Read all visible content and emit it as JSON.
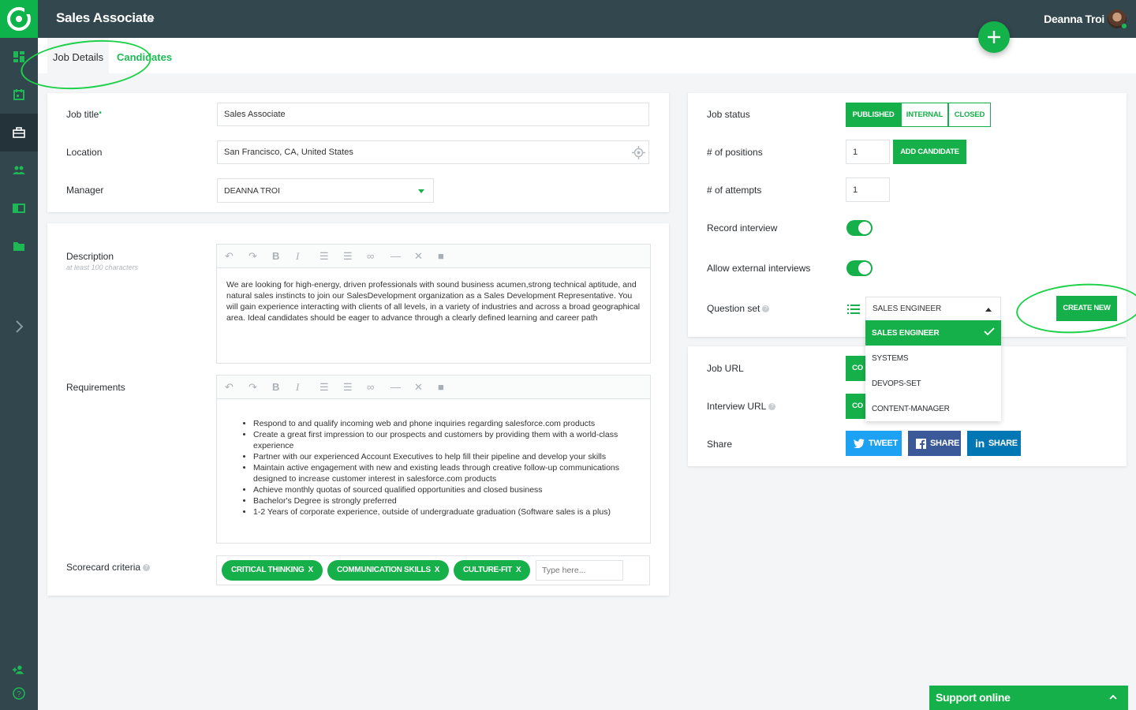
{
  "header": {
    "title": "Sales Associate",
    "user_name": "Deanna Troi"
  },
  "tabs": [
    {
      "label": "Job Details"
    },
    {
      "label": "Candidates"
    }
  ],
  "job_form": {
    "job_title_label": "Job title",
    "job_title_value": "Sales Associate",
    "location_label": "Location",
    "location_value": "San Francisco, CA, United States",
    "manager_label": "Manager",
    "manager_value": "DEANNA TROI"
  },
  "description": {
    "label": "Description",
    "hint": "at least 100 characters",
    "text": "We are looking for high-energy, driven professionals with sound business acumen,strong technical aptitude, and natural sales instincts to join our SalesDevelopment organization as a Sales Development Representative. You will gain experience interacting with clients of all levels, in a variety of industries and across a broad geographical area. Ideal candidates should be eager to advance through a clearly defined learning and career path"
  },
  "requirements": {
    "label": "Requirements",
    "items": [
      "Respond to and qualify incoming web and phone inquiries regarding     salesforce.com products",
      "Create a great first impression to our prospects and customers by     providing them with a world-class experience",
      "Partner with our experienced Account Executives to help fill their     pipeline and develop your skills",
      " Maintain active engagement with new and existing leads through     creative follow-up communications designed to increase customer interest     in salesforce.com products",
      " Achieve monthly quotas of sourced qualified opportunities and     closed business",
      " Bachelor's Degree is strongly preferred",
      " 1-2 Years of corporate experience, outside of undergraduate     graduation (Software sales is a plus)"
    ]
  },
  "scorecard": {
    "label": "Scorecard criteria",
    "tags": [
      "CRITICAL THINKING",
      "COMMUNICATION SKILLS",
      "CULTURE-FIT"
    ],
    "remove_label": "X",
    "placeholder": "Type here..."
  },
  "job_settings": {
    "status_label": "Job status",
    "status_options": [
      "PUBLISHED",
      "INTERNAL",
      "CLOSED"
    ],
    "status_selected": "PUBLISHED",
    "positions_label": "# of positions",
    "positions_value": "1",
    "add_candidate_label": "ADD CANDIDATE",
    "attempts_label": "# of attempts",
    "attempts_value": "1",
    "record_label": "Record interview",
    "record_on": true,
    "external_label": "Allow external interviews",
    "external_on": true,
    "question_set_label": "Question set",
    "question_set_value": "SALES ENGINEER",
    "question_set_options": [
      "SALES ENGINEER",
      "SYSTEMS",
      "DEVOPS-SET",
      "CONTENT-MANAGER"
    ],
    "create_new_label": "CREATE NEW"
  },
  "urls": {
    "job_url_label": "Job URL",
    "interview_url_label": "Interview URL",
    "copy_label": "CO",
    "share_label": "Share",
    "tweet_label": "TWEET",
    "fb_share_label": "SHARE",
    "li_share_label": "SHARE"
  },
  "support": {
    "label": "Support online"
  },
  "colors": {
    "accent": "#16b04a",
    "sidebar": "#31464d",
    "twitter": "#1da1f2",
    "facebook": "#3b5998",
    "linkedin": "#0077b5"
  }
}
